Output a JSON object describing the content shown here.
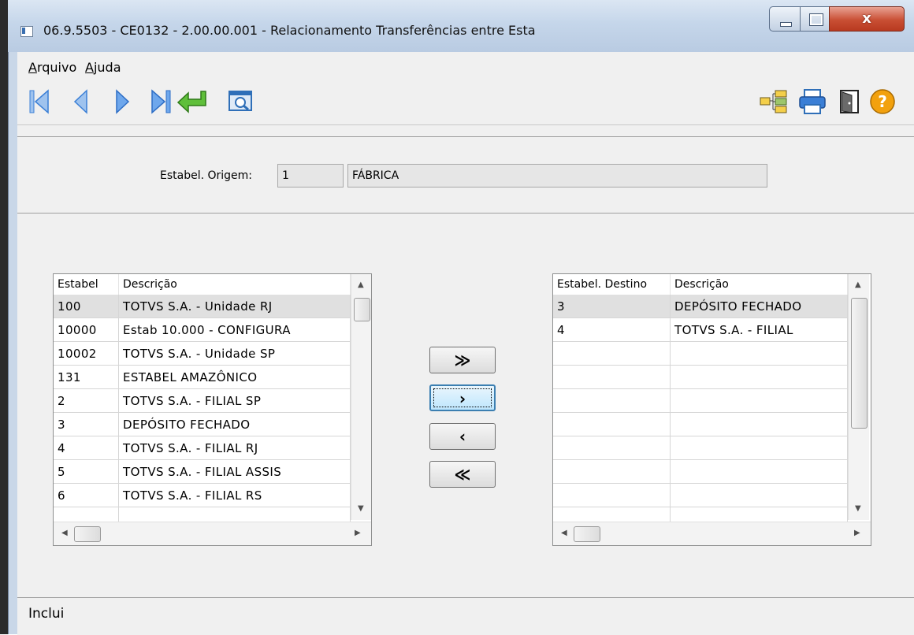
{
  "window": {
    "title": "06.9.5503 - CE0132 - 2.00.00.001 - Relacionamento Transferências entre Esta",
    "close_glyph": "x"
  },
  "menu": {
    "items": [
      {
        "label": "Arquivo",
        "accel": "A",
        "rest": "rquivo"
      },
      {
        "label": "Ajuda",
        "accel": "A",
        "rest": "juda"
      }
    ]
  },
  "toolbar": {
    "left_icons": [
      "first-record-icon",
      "prev-record-icon",
      "next-record-icon",
      "last-record-icon",
      "goto-return-icon",
      "search-zoom-icon"
    ],
    "right_icons": [
      "tree-structure-icon",
      "printer-icon",
      "exit-door-icon",
      "help-icon"
    ]
  },
  "header": {
    "origin_label": "Estabel. Origem:",
    "origin_code": "1",
    "origin_name": "FÁBRICA"
  },
  "left_grid": {
    "columns": [
      "Estabel",
      "Descrição"
    ],
    "rows": [
      [
        "100",
        "TOTVS S.A. - Unidade RJ"
      ],
      [
        "10000",
        "Estab 10.000 - CONFIGURA"
      ],
      [
        "10002",
        "TOTVS S.A. - Unidade SP"
      ],
      [
        "131",
        "ESTABEL AMAZÔNICO"
      ],
      [
        "2",
        "TOTVS S.A. - FILIAL SP"
      ],
      [
        "3",
        "DEPÓSITO FECHADO"
      ],
      [
        "4",
        "TOTVS S.A. - FILIAL RJ"
      ],
      [
        "5",
        "TOTVS S.A. - FILIAL ASSIS"
      ],
      [
        "6",
        "TOTVS S.A. - FILIAL RS"
      ]
    ]
  },
  "right_grid": {
    "columns": [
      "Estabel. Destino",
      "Descrição"
    ],
    "rows": [
      [
        "3",
        "DEPÓSITO FECHADO"
      ],
      [
        "4",
        "TOTVS S.A. - FILIAL"
      ]
    ]
  },
  "move_buttons": {
    "add_all": "≫",
    "add_one": "›",
    "remove_one": "‹",
    "remove_all": "≪"
  },
  "status": {
    "text": "Inclui"
  },
  "colors": {
    "title_gradient": "#c5d6ea",
    "close_button": "#c94f34",
    "nav_blue": "#3b7fd6",
    "return_green": "#4aa030",
    "help_orange": "#f2a10e"
  }
}
